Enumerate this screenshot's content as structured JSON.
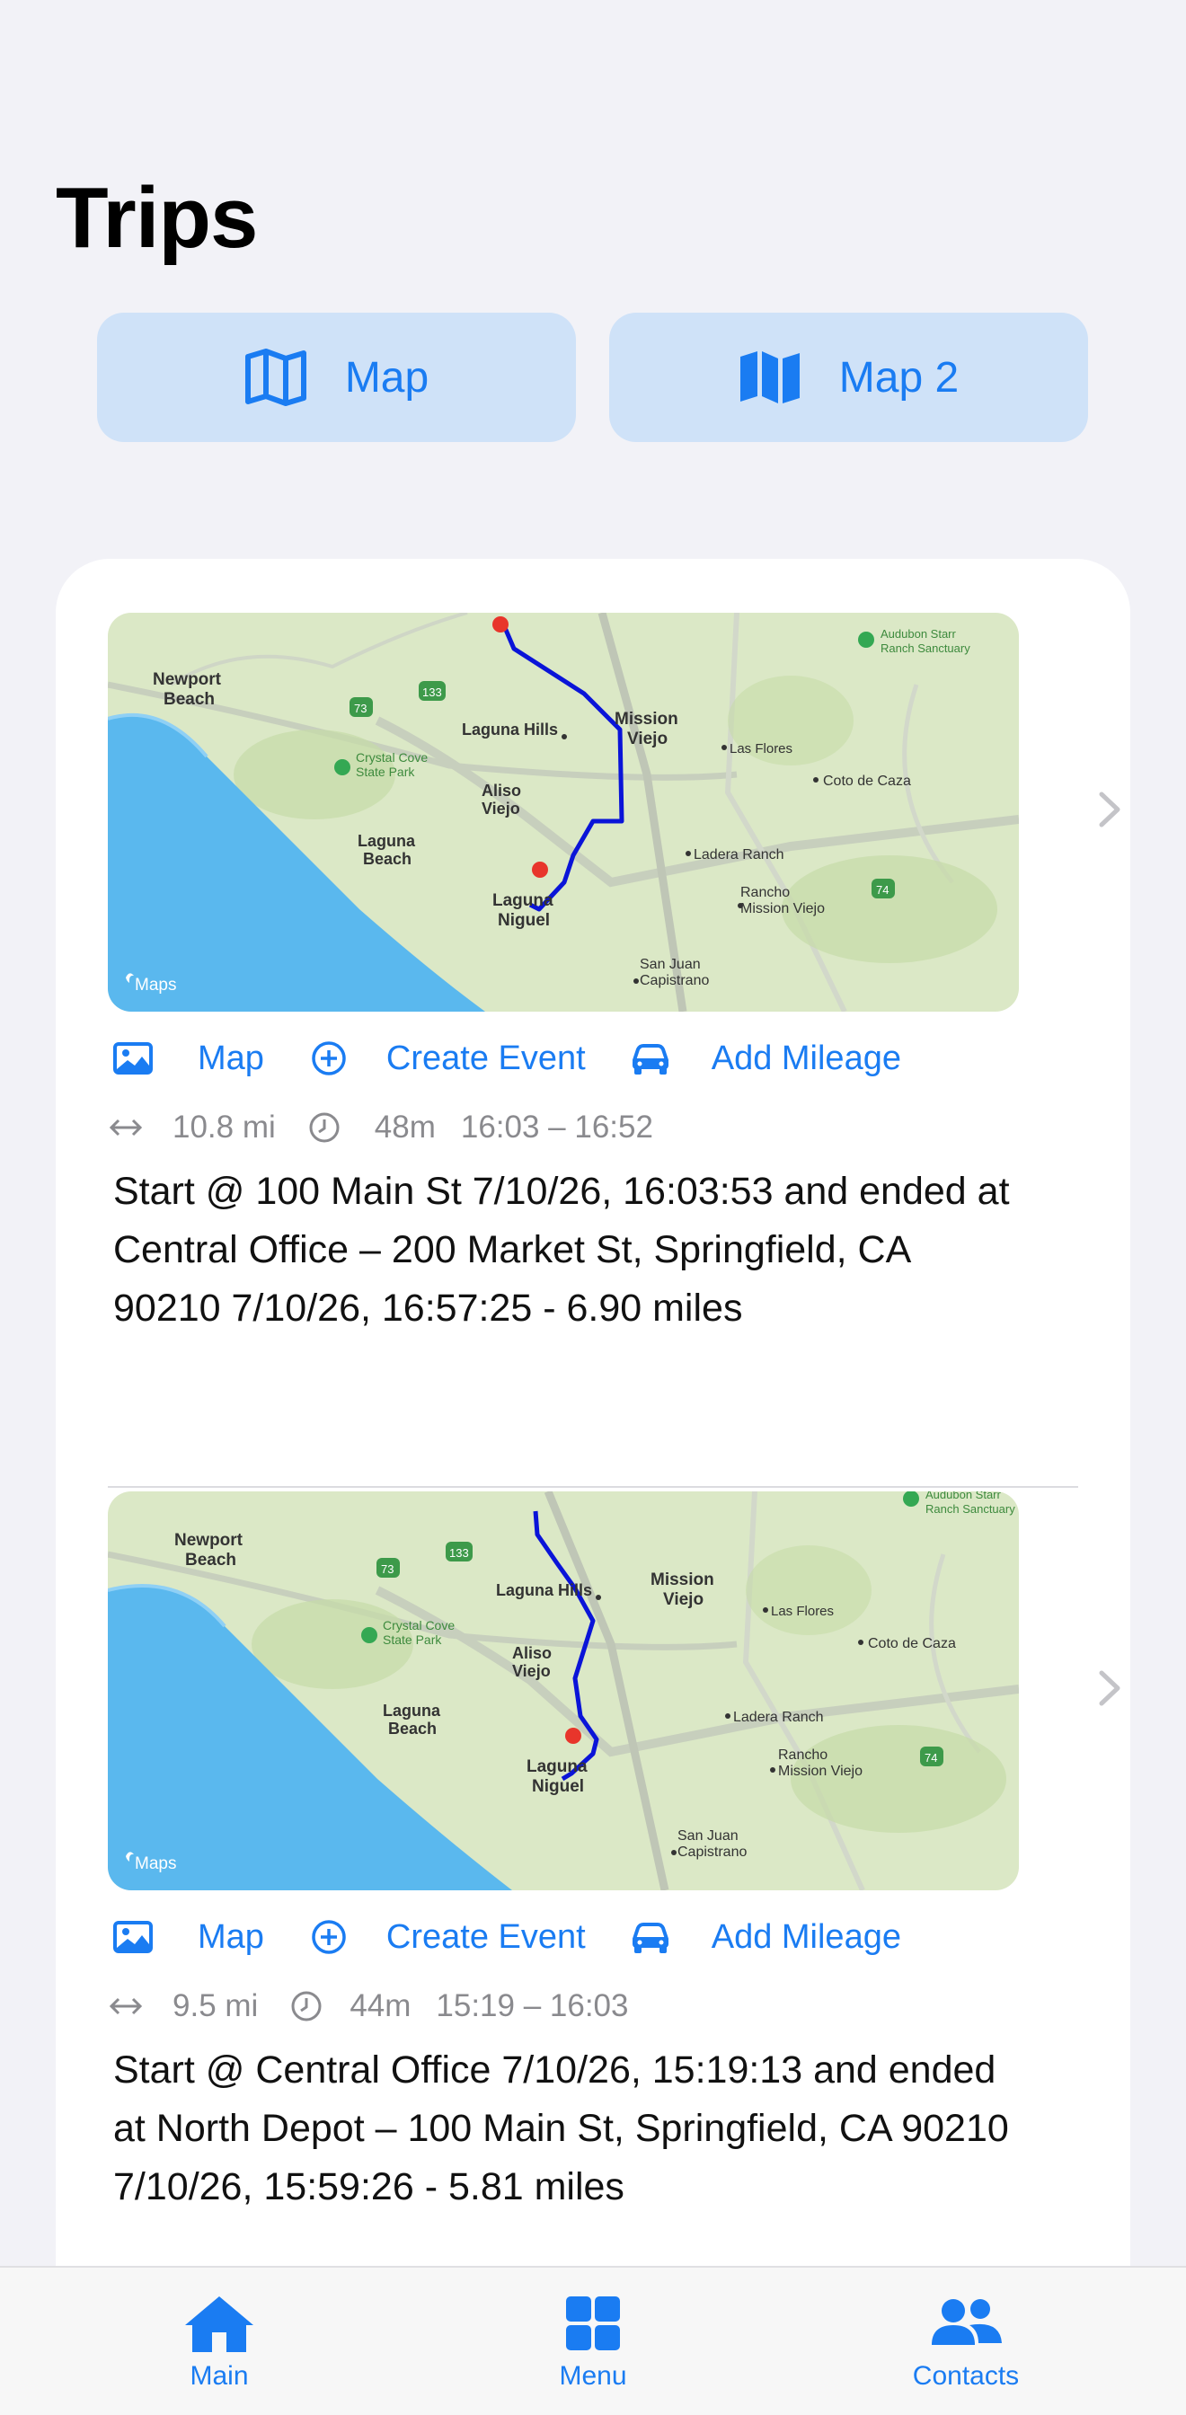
{
  "page": {
    "title": "Trips"
  },
  "top_buttons": {
    "map": {
      "label": "Map",
      "icon": "map-outline-icon"
    },
    "map2": {
      "label": "Map 2",
      "icon": "map-filled-icon"
    }
  },
  "trips": [
    {
      "map_labels": {
        "newport": "Newport",
        "beach": "Beach",
        "laguna_hills": "Laguna Hills",
        "mission": "Mission",
        "viejo": "Viejo",
        "aliso": "Aliso",
        "aliso_viejo": "Viejo",
        "crystal": "Crystal Cove",
        "state_park": "State Park",
        "laguna": "Laguna",
        "laguna_beach": "Beach",
        "laguna2": "Laguna",
        "niguel": "Niguel",
        "las_flores": "Las Flores",
        "coto": "Coto de Caza",
        "ladera": "Ladera Ranch",
        "rancho": "Rancho",
        "rancho_mv": "Mission Viejo",
        "san_juan": "San Juan",
        "capistrano": "Capistrano",
        "audubon": "Audubon Starr",
        "ranch_sanctuary": "Ranch Sanctuary",
        "hwy133": "133",
        "hwy73": "73",
        "hwy74": "74",
        "apple_maps": "Maps"
      },
      "actions": {
        "map": "Map",
        "create_event": "Create Event",
        "add_mileage": "Add Mileage"
      },
      "stats": {
        "distance": "10.8 mi",
        "duration": "48m",
        "time_range": "16:03 – 16:52"
      },
      "description": "Start @ 100 Main St 7/10/26, 16:03:53 and ended at Central Office – 200 Market St, Springfield, CA 90210 7/10/26, 16:57:25 - 6.90 miles"
    },
    {
      "map_labels": {
        "newport": "Newport",
        "beach": "Beach",
        "laguna_hills": "Laguna Hills",
        "mission": "Mission",
        "viejo": "Viejo",
        "aliso": "Aliso",
        "aliso_viejo": "Viejo",
        "crystal": "Crystal Cove",
        "state_park": "State Park",
        "laguna": "Laguna",
        "laguna_beach": "Beach",
        "laguna2": "Laguna",
        "niguel": "Niguel",
        "las_flores": "Las Flores",
        "coto": "Coto de Caza",
        "ladera": "Ladera Ranch",
        "rancho": "Rancho",
        "rancho_mv": "Mission Viejo",
        "san_juan": "San Juan",
        "capistrano": "Capistrano",
        "audubon": "Audubon Starr",
        "ranch_sanctuary": "Ranch Sanctuary",
        "hwy133": "133",
        "hwy73": "73",
        "hwy74": "74",
        "apple_maps": "Maps"
      },
      "actions": {
        "map": "Map",
        "create_event": "Create Event",
        "add_mileage": "Add Mileage"
      },
      "stats": {
        "distance": "9.5 mi",
        "duration": "44m",
        "time_range": "15:19 – 16:03"
      },
      "description": "Start @ Central Office 7/10/26, 15:19:13 and ended at North Depot – 100 Main St, Springfield, CA 90210 7/10/26, 15:59:26 - 5.81 miles"
    }
  ],
  "tabbar": {
    "items": [
      {
        "label": "Main",
        "icon": "house-icon"
      },
      {
        "label": "Menu",
        "icon": "grid-icon"
      },
      {
        "label": "Contacts",
        "icon": "people-icon"
      }
    ]
  },
  "colors": {
    "accent": "#1a7cf2",
    "route": "#0a14d8",
    "water": "#5ab8ee",
    "land": "#dbe8c6"
  }
}
